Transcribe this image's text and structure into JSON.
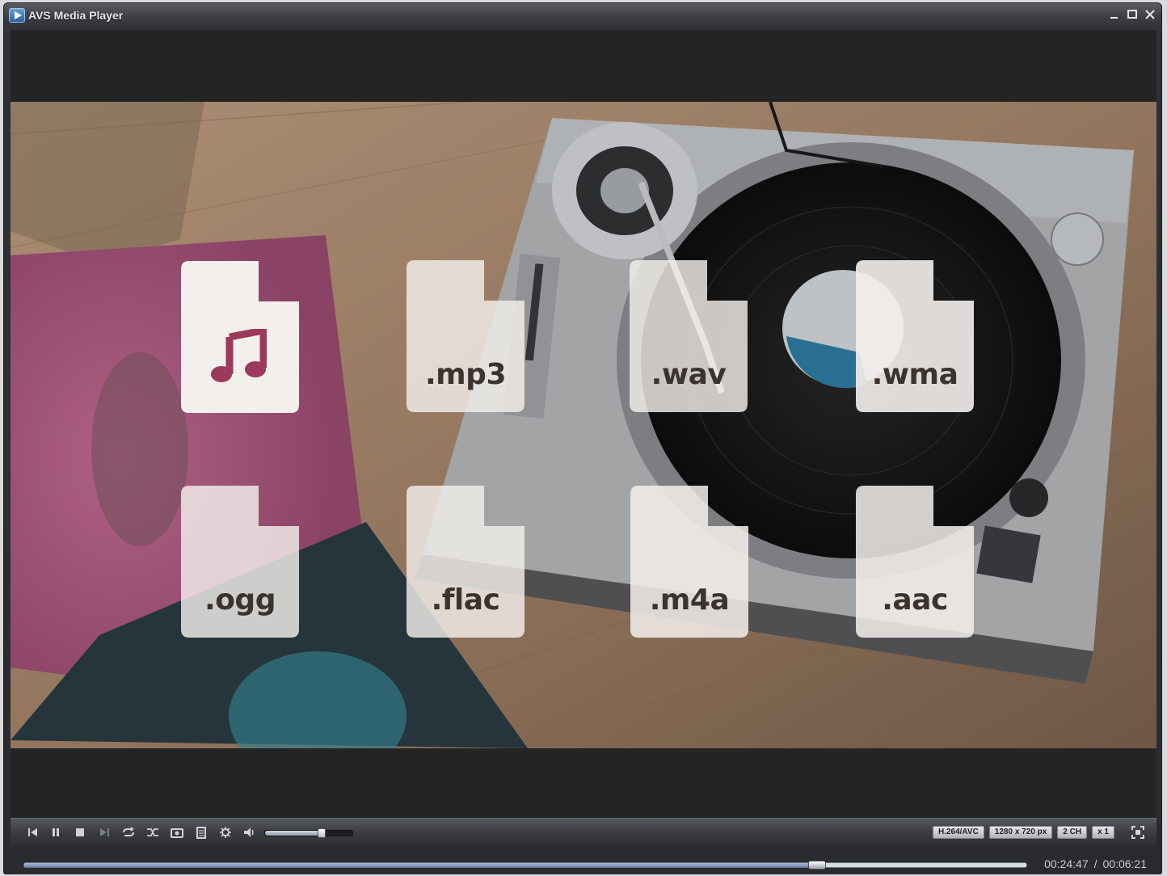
{
  "window": {
    "title": "AVS Media Player"
  },
  "overlay": {
    "files": [
      {
        "ext": "",
        "icon": "music-note-icon"
      },
      {
        "ext": ".mp3"
      },
      {
        "ext": ".wav"
      },
      {
        "ext": ".wma"
      },
      {
        "ext": ".ogg"
      },
      {
        "ext": ".flac"
      },
      {
        "ext": ".m4a"
      },
      {
        "ext": ".aac"
      }
    ],
    "accent_color": "#9b3a5c"
  },
  "controls": {
    "buttons": [
      "previous-icon",
      "pause-icon",
      "stop-icon",
      "next-icon",
      "repeat-icon",
      "shuffle-icon",
      "snapshot-icon",
      "playlist-icon",
      "settings-icon",
      "volume-icon"
    ],
    "volume_level": 0.65,
    "badges": {
      "codec": "H.264/AVC",
      "resolution": "1280 x 720 px",
      "channels": "2 CH",
      "speed": "x 1"
    }
  },
  "seek": {
    "progress": 0.79,
    "current_time": "00:24:47",
    "total_time": "00:06:21",
    "separator": "/"
  }
}
